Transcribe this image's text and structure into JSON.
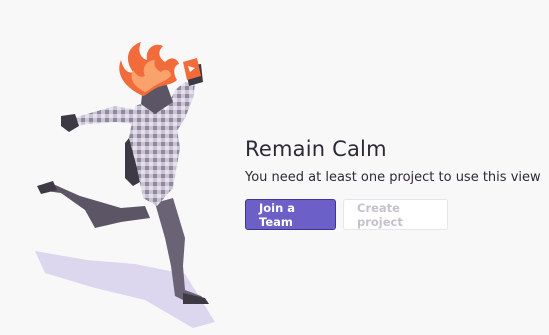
{
  "empty_state": {
    "title": "Remain Calm",
    "message": "You need at least one project to use this view",
    "primary_button_label": "Join a Team",
    "secondary_button_label": "Create project",
    "illustration": "running-person-with-flaming-head-icon"
  },
  "colors": {
    "background": "#f9f8f9",
    "text": "#2f2936",
    "primary": "#6c5fc7",
    "primary_border": "#3d3598",
    "disabled_text": "#c6c2cc",
    "disabled_border": "#e7e4ec",
    "flame": "#f26b3a",
    "shadow": "#dcd6ee"
  }
}
